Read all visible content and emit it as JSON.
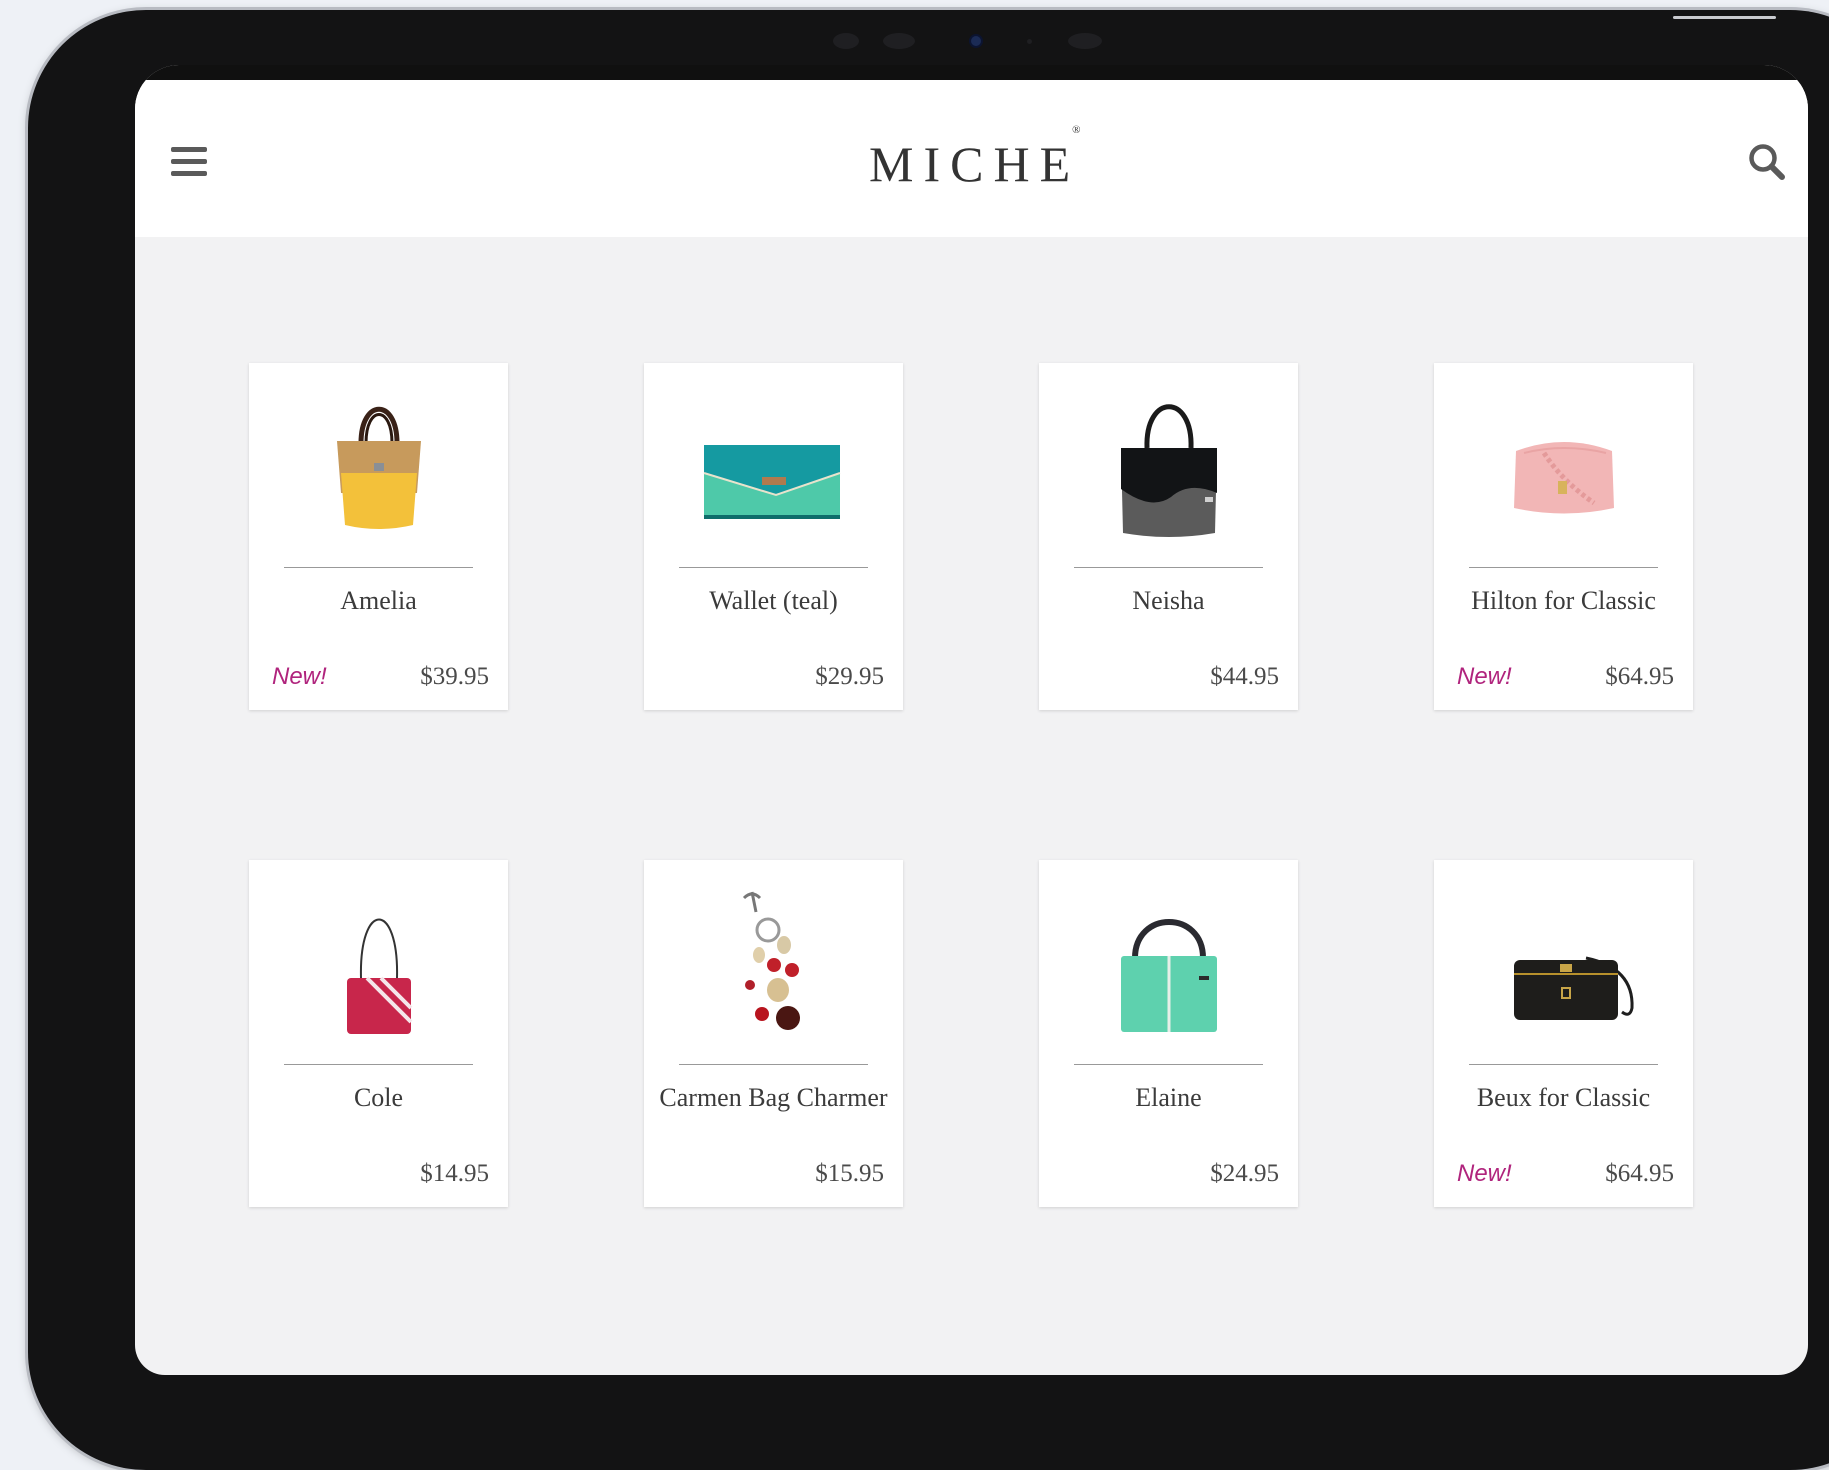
{
  "header": {
    "logo_text": "MICHE",
    "logo_mark": "®",
    "menu_icon": "hamburger-menu-icon",
    "search_icon": "magnifier-icon"
  },
  "colors": {
    "accent_new": "#b0247d",
    "page_bg": "#f2f2f3",
    "device_frame": "#131314"
  },
  "products": [
    {
      "name": "Amelia",
      "price": "$39.95",
      "badge": "New!"
    },
    {
      "name": "Wallet (teal)",
      "price": "$29.95",
      "badge": ""
    },
    {
      "name": "Neisha",
      "price": "$44.95",
      "badge": ""
    },
    {
      "name": "Hilton for Classic",
      "price": "$64.95",
      "badge": "New!"
    },
    {
      "name": "Cole",
      "price": "$14.95",
      "badge": ""
    },
    {
      "name": "Carmen Bag Charmer",
      "price": "$15.95",
      "badge": ""
    },
    {
      "name": "Elaine",
      "price": "$24.95",
      "badge": ""
    },
    {
      "name": "Beux for Classic",
      "price": "$64.95",
      "badge": "New!"
    }
  ]
}
